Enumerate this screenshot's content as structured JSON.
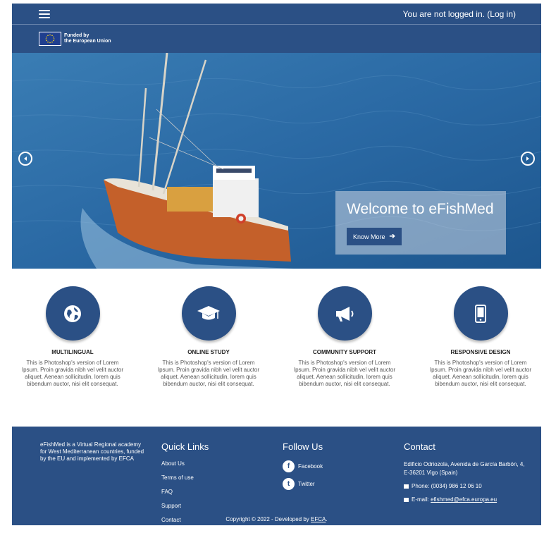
{
  "header": {
    "login_text": "You are not logged in. (Log in)",
    "funded_line1": "Funded by",
    "funded_line2": "the European Union"
  },
  "hero": {
    "title": "Welcome to eFishMed",
    "button_label": "Know More"
  },
  "features": [
    {
      "icon": "globe-icon",
      "title": "MULTILINGUAL",
      "text": "This is Photoshop's version of Lorem Ipsum. Proin gravida nibh vel velit auctor aliquet. Aenean sollicitudin, lorem quis bibendum auctor, nisi elit consequat."
    },
    {
      "icon": "graduation-cap-icon",
      "title": "ONLINE STUDY",
      "text": "This is Photoshop's version of Lorem Ipsum. Proin gravida nibh vel velit auctor aliquet. Aenean sollicitudin, lorem quis bibendum auctor, nisi elit consequat."
    },
    {
      "icon": "megaphone-icon",
      "title": "COMMUNITY SUPPORT",
      "text": "This is Photoshop's version of Lorem Ipsum. Proin gravida nibh vel velit auctor aliquet. Aenean sollicitudin, lorem quis bibendum auctor, nisi elit consequat."
    },
    {
      "icon": "mobile-icon",
      "title": "RESPONSIVE DESIGN",
      "text": "This is Photoshop's version of Lorem Ipsum. Proin gravida nibh vel velit auctor aliquet. Aenean sollicitudin, lorem quis bibendum auctor, nisi elit consequat."
    }
  ],
  "footer": {
    "about": "eFishMed is a Virtual Regional academy for West Mediterranean countries, funded by the EU and implemented by EFCA",
    "quick_links_title": "Quick Links",
    "quick_links": [
      "About Us",
      "Terms of use",
      "FAQ",
      "Support",
      "Contact"
    ],
    "follow_title": "Follow Us",
    "social": [
      {
        "icon": "facebook-icon",
        "glyph": "f",
        "label": "Facebook"
      },
      {
        "icon": "twitter-icon",
        "glyph": "t",
        "label": "Twitter"
      }
    ],
    "contact_title": "Contact",
    "address": "Edificio Odriozola, Avenida de García Barbón, 4, E-36201 Vigo (Spain)",
    "phone": "Phone: (0034) 986 12 06 10",
    "email_prefix": "E-mail: ",
    "email": "efishmed@efca.europa.eu",
    "copyright_prefix": "Copyright © 2022 - Developed by ",
    "copyright_link": "EFCA",
    "copyright_suffix": "."
  },
  "colors": {
    "primary": "#2b5085",
    "sea": "#2a6aa6",
    "hull": "#c4602a"
  }
}
